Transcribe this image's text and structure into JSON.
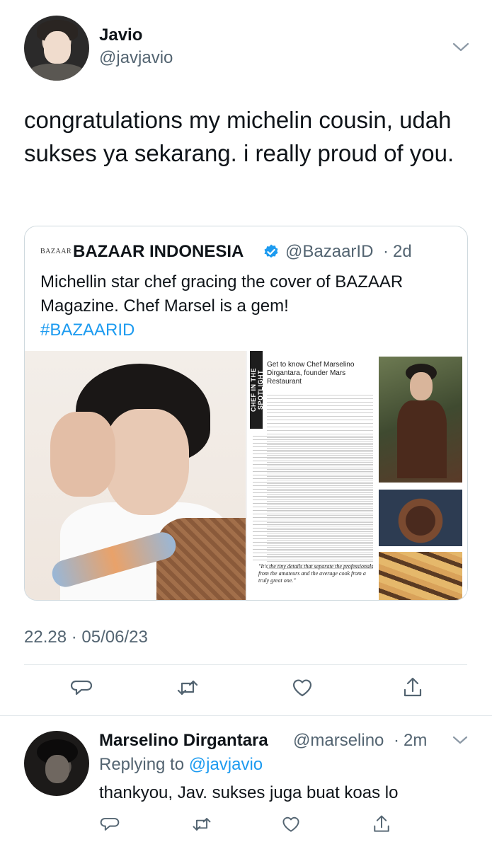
{
  "tweet": {
    "display_name": "Javio",
    "handle": "@javjavio",
    "text": "congratulations my michelin cousin, udah sukses ya sekarang. i really proud of you.",
    "timestamp": "22.28 · 05/06/23"
  },
  "quoted": {
    "logo": "BAZAAR",
    "name": "BAZAAR INDONESIA",
    "handle": "@BazaarID",
    "separator": "·",
    "time": "2d",
    "text": "Michellin star chef gracing the cover of BAZAAR Magazine. Chef Marsel is a gem!",
    "hashtag": "#BAZAARID",
    "article_spine": "CHEF IN THE SPOTLIGHT",
    "article_headline": "Get to know Chef Marselino Dirgantara, founder Mars Restaurant",
    "article_quote": "\"It's the tiny details that separate the professionals from the amateurs and the average cook from a truly great one.\""
  },
  "reply": {
    "display_name": "Marselino Dirgantara",
    "handle": "@marselino",
    "separator": "·",
    "time": "2m",
    "replying_prefix": "Replying to",
    "replying_to": "@javjavio",
    "text": "thankyou, Jav. sukses juga buat koas lo"
  },
  "icons": {
    "reply": "reply-icon",
    "retweet": "retweet-icon",
    "like": "heart-icon",
    "share": "share-icon",
    "more": "chevron-down-icon",
    "verified": "verified-badge-icon"
  },
  "colors": {
    "link": "#1d9bf0",
    "secondary_text": "#536471",
    "icon_gray": "#536471"
  }
}
